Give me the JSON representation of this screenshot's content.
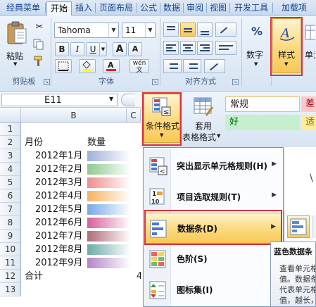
{
  "tabs": [
    "经典菜单",
    "开始",
    "插入",
    "页面布局",
    "公式",
    "数据",
    "审阅",
    "视图",
    "开发工具",
    "加载项"
  ],
  "active_tab": "开始",
  "clipboard": {
    "paste_label": "粘贴",
    "group_label": "剪贴板"
  },
  "font": {
    "family": "Tahoma",
    "size": "11",
    "group_label": "字体",
    "bold": "B",
    "italic": "I",
    "underline": "U",
    "grow": "A",
    "shrink": "A",
    "phonetic": "wén"
  },
  "alignment": {
    "group_label": "对齐方式"
  },
  "number": {
    "label": "数字",
    "percent": "%"
  },
  "styles_button": {
    "label": "样式"
  },
  "cells_button": {
    "label": "单元"
  },
  "name_box": "E11",
  "fx": "fx",
  "columns": [
    "B",
    "C"
  ],
  "rows": [
    "1",
    "2",
    "3",
    "4",
    "5",
    "6",
    "7",
    "8",
    "9",
    "10",
    "11",
    "12",
    "13"
  ],
  "headers": {
    "month": "月份",
    "quantity": "数量"
  },
  "months": [
    "2012年1月",
    "2012年2月",
    "2012年3月",
    "2012年4月",
    "2012年5月",
    "2012年6月",
    "2012年7月",
    "2012年8月",
    "2012年9月"
  ],
  "total_label": "合计",
  "total_partial": "4",
  "bar_colors": [
    "#9fb0d9",
    "#8dc98f",
    "#ef8d8d",
    "#f5b25e",
    "#77a9e6",
    "#d75f9d",
    "#b06a7a",
    "#6ea9a6",
    "#b286c9"
  ],
  "conditional_format": {
    "label": "条件格式"
  },
  "table_format": {
    "label_top": "套用",
    "label_bottom": "表格格式"
  },
  "cell_styles": {
    "normal": "常规",
    "bad": "差",
    "good": "好",
    "neutral": "适"
  },
  "menu": {
    "items": [
      {
        "label": "突出显示单元格规则(H)"
      },
      {
        "label": "项目选取规则(T)"
      },
      {
        "label": "数据条(D)"
      },
      {
        "label": "色阶(S)"
      },
      {
        "label": "图标集(I)"
      }
    ]
  },
  "tooltip": {
    "title": "蓝色数据条",
    "body": "查看单元格中的值。数据条的长度代表单元格中的值，越长，则值越"
  }
}
